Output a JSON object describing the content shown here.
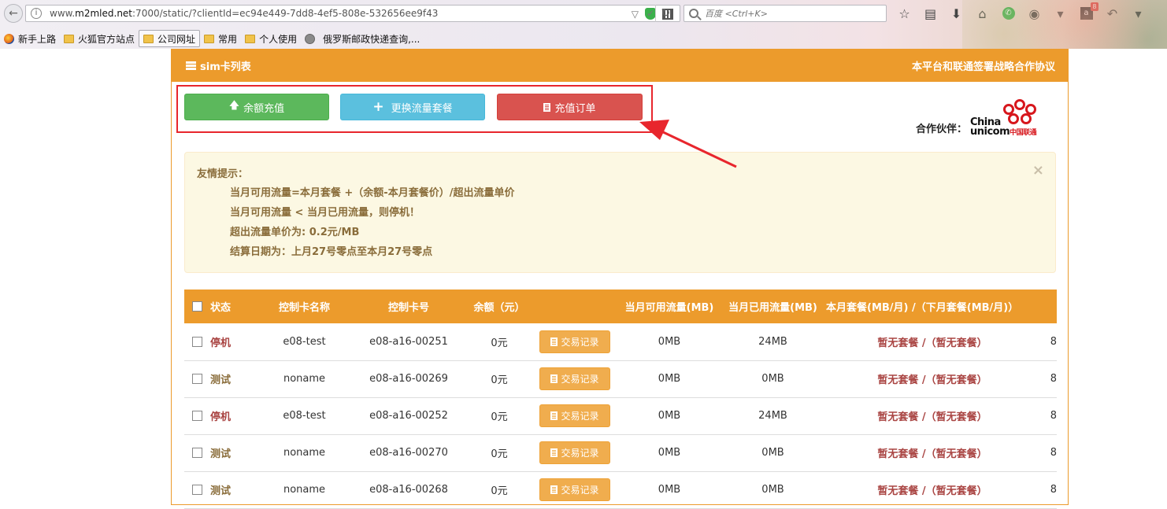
{
  "browser": {
    "url_prefix": "www.",
    "url_host": "m2mled.net",
    "url_rest": ":7000/static/?clientId=ec94e449-7dd8-4ef5-808e-532656ee9f43",
    "search_placeholder": "百度 <Ctrl+K>",
    "bookmarks": [
      "新手上路",
      "火狐官方站点",
      "公司网址",
      "常用",
      "个人使用",
      "俄罗斯邮政快递查询,..."
    ],
    "adblock_badge": "8"
  },
  "panel": {
    "title": "sim卡列表",
    "agreement_link": "本平台和联通签署战略合作协议",
    "partner_label": "合作伙伴：",
    "partner_logo_text_en_1": "China",
    "partner_logo_text_en_2": "unicom",
    "partner_logo_text_cn": "中国联通"
  },
  "actions": {
    "recharge": "余额充值",
    "change_package": "更换流量套餐",
    "orders": "充值订单"
  },
  "notice": {
    "title": "友情提示：",
    "lines": [
      "当月可用流量=本月套餐 +（余额-本月套餐价）/超出流量单价",
      "当月可用流量 < 当月已用流量，则停机！",
      "超出流量单价为: 0.2元/MB",
      "结算日期为：上月27号零点至本月27号零点"
    ],
    "close": "×"
  },
  "table": {
    "headers": [
      "状态",
      "控制卡名称",
      "控制卡号",
      "余额（元）",
      "",
      "当月可用流量(MB)",
      "当月已用流量(MB)",
      "本月套餐(MB/月) /（下月套餐(MB/月)）"
    ],
    "record_button": "交易记录",
    "rows": [
      {
        "status": "停机",
        "name": "e08-test",
        "card": "e08-a16-00251",
        "balance": "0元",
        "available": "0MB",
        "used": "24MB",
        "package": "暂无套餐 /（暂无套餐）",
        "more": "8"
      },
      {
        "status": "测试",
        "name": "noname",
        "card": "e08-a16-00269",
        "balance": "0元",
        "available": "0MB",
        "used": "0MB",
        "package": "暂无套餐 /（暂无套餐）",
        "more": "8"
      },
      {
        "status": "停机",
        "name": "e08-test",
        "card": "e08-a16-00252",
        "balance": "0元",
        "available": "0MB",
        "used": "24MB",
        "package": "暂无套餐 /（暂无套餐）",
        "more": "8"
      },
      {
        "status": "测试",
        "name": "noname",
        "card": "e08-a16-00270",
        "balance": "0元",
        "available": "0MB",
        "used": "0MB",
        "package": "暂无套餐 /（暂无套餐）",
        "more": "8"
      },
      {
        "status": "测试",
        "name": "noname",
        "card": "e08-a16-00268",
        "balance": "0元",
        "available": "0MB",
        "used": "0MB",
        "package": "暂无套餐 /（暂无套餐）",
        "more": "8"
      }
    ]
  },
  "colors": {
    "primary": "#ec9b2c",
    "success": "#5cb85c",
    "info": "#5bc0de",
    "danger": "#d9534f",
    "warning": "#f0ad4e",
    "annotation": "#e8262d"
  }
}
